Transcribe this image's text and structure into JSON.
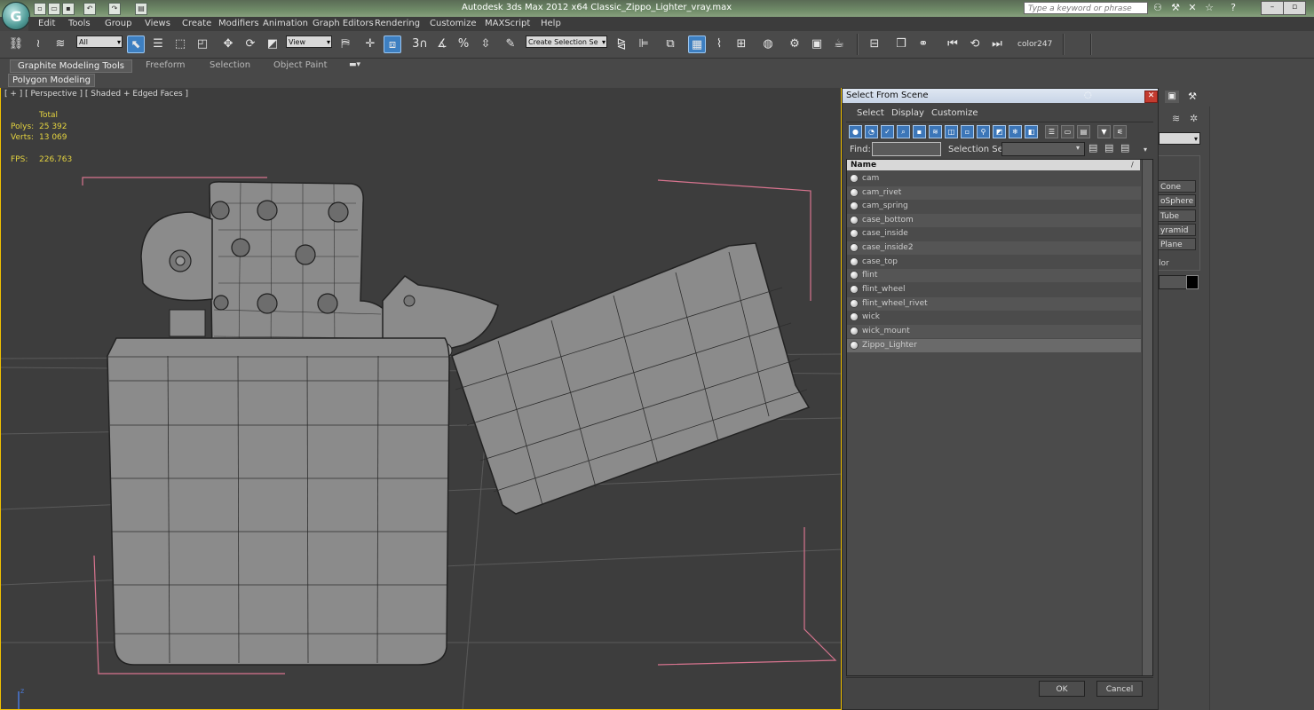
{
  "window": {
    "title": "Autodesk 3ds Max  2012 x64      Classic_Zippo_Lighter_vray.max",
    "search_placeholder": "Type a keyword or phrase"
  },
  "menu": [
    "Edit",
    "Tools",
    "Group",
    "Views",
    "Create",
    "Modifiers",
    "Animation",
    "Graph Editors",
    "Rendering",
    "Customize",
    "MAXScript",
    "Help"
  ],
  "toolbar": {
    "selection_filter": "All",
    "reference_coord": "View",
    "named_selection": "Create Selection Se",
    "snap_label": "3",
    "object_color_label": "color247"
  },
  "ribbon": {
    "tabs": [
      "Graphite Modeling Tools",
      "Freeform",
      "Selection",
      "Object Paint"
    ],
    "panel": "Polygon Modeling"
  },
  "viewport": {
    "label": "[ + ] [ Perspective ] [ Shaded + Edged Faces ]",
    "stats": {
      "total_label": "Total",
      "polys_label": "Polys:",
      "polys_value": "25 392",
      "verts_label": "Verts:",
      "verts_value": "13 069",
      "fps_label": "FPS:",
      "fps_value": "226.763"
    }
  },
  "right_panel": {
    "buttons": [
      "Cone",
      "oSphere",
      "Tube",
      "yramid",
      "Plane"
    ],
    "color_label": "lor"
  },
  "dialog": {
    "title": "Select From Scene",
    "menu": [
      "Select",
      "Display",
      "Customize"
    ],
    "find_label": "Find:",
    "selection_set_label": "Selection Set:",
    "column_name": "Name",
    "items": [
      "cam",
      "cam_rivet",
      "cam_spring",
      "case_bottom",
      "case_inside",
      "case_inside2",
      "case_top",
      "flint",
      "flint_wheel",
      "flint_wheel_rivet",
      "wick",
      "wick_mount",
      "Zippo_Lighter"
    ],
    "ok_label": "OK",
    "cancel_label": "Cancel"
  },
  "colors": {
    "viewport_bg": "#3d3d3d",
    "viewport_border": "#f0c000",
    "mesh_fill": "#8a8a8a",
    "selection_bracket": "#d8748f",
    "stat_text": "#e3d23f",
    "toolbar_active": "#3d7fc1"
  }
}
